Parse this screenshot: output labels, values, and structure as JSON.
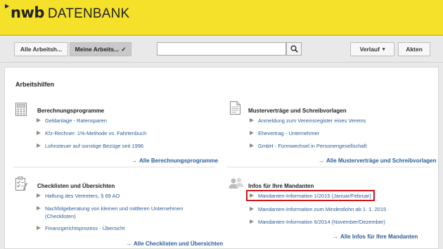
{
  "header": {
    "brand": "nwb",
    "product": "DATENBANK"
  },
  "toolbar": {
    "all_tools": "Alle Arbeitsh...",
    "my_tools": "Meine Arbeits...",
    "my_tools_check": "✓",
    "search_placeholder": "",
    "history": "Verlauf",
    "history_caret": "▾",
    "files": "Akten"
  },
  "main": {
    "title": "Arbeitshilfen",
    "panels": {
      "calc": {
        "title": "Berechnungsprogramme",
        "items": [
          "Geldanlage - Ratensparen",
          "Kfz-Rechner: 1%-Methode vs. Fahrtenbuch",
          "Lohnsteuer auf sonstige Bezüge seit 1996"
        ],
        "more": "Alle Berechnungsprogramme"
      },
      "templates": {
        "title": "Musterverträge und Schreibvorlagen",
        "items": [
          "Anmeldung zum Vereinsregister eines Vereins",
          "Ehevertrag - Unternehmer",
          "GmbH - Formwechsel in Personengesellschaft"
        ],
        "more": "Alle Musterverträge und Schreibvorlagen"
      },
      "checklists": {
        "title": "Checklisten und Übersichten",
        "items": [
          "Haftung des Vertreters, § 69 AO",
          "Nachfolgeberatung von kleinen und mittleren Unternehmen",
          "(Checklisten)",
          "Finanzgerichtsprozess - Übersicht"
        ],
        "more": "Alle Checklisten und Übersichten"
      },
      "clients": {
        "title": "Infos für Ihre Mandanten",
        "items": [
          "Mandanten-Information 1/2015 (Januar/Februar)",
          "Mandanten-Information zum Mindestlohn ab 1. 1. 2015",
          "Mandanten-Information 6/2014 (November/Dezember)"
        ],
        "more": "Alle Infos für Ihre Mandanten"
      }
    },
    "more_arrow": "→"
  },
  "colors": {
    "header_yellow": "#f5e12a",
    "link_blue": "#2c5c99",
    "highlight_red": "#d0141b"
  },
  "icons": [
    "calculator-icon",
    "document-icon",
    "checklist-icon",
    "people-icon",
    "search-icon",
    "triangle-bullet-icon",
    "arrow-right-icon"
  ]
}
